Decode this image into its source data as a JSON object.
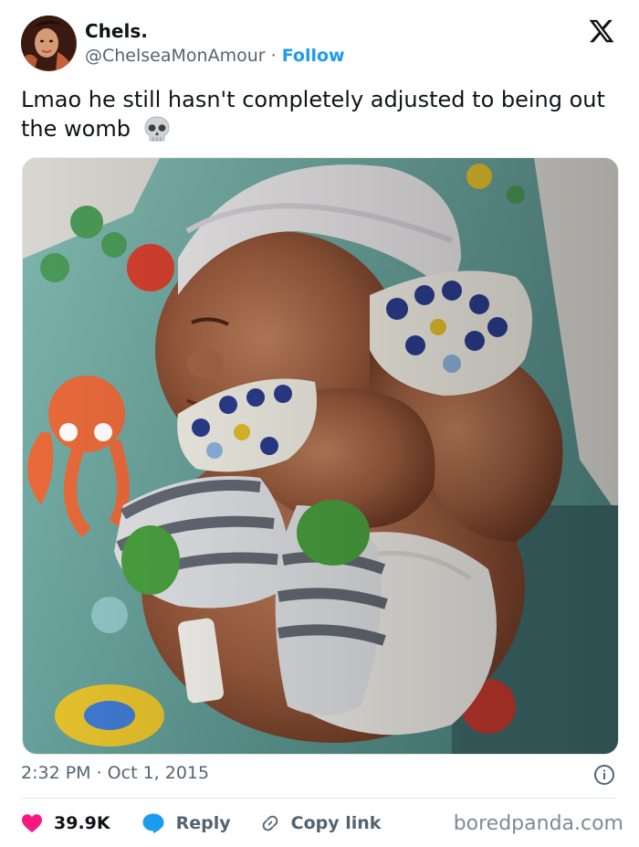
{
  "author": {
    "name": "Chels.",
    "handle": "@ChelseaMonAmour",
    "separator": "·",
    "follow_label": "Follow"
  },
  "tweet": {
    "text": "Lmao he still hasn't completely adjusted to being out the womb",
    "emoji_icon": "skull-emoji-icon"
  },
  "photo": {
    "icon": "newborn-baby-photo"
  },
  "meta": {
    "timestamp": "2:32 PM · Oct 1, 2015"
  },
  "actions": {
    "like_count": "39.9K",
    "reply_label": "Reply",
    "copy_link_label": "Copy link"
  },
  "watermark": "boredpanda.com",
  "colors": {
    "follow": "#1d9bf0",
    "like_heart": "#f91880",
    "reply_bubble": "#1d9bf0",
    "secondary_text": "#536471"
  }
}
